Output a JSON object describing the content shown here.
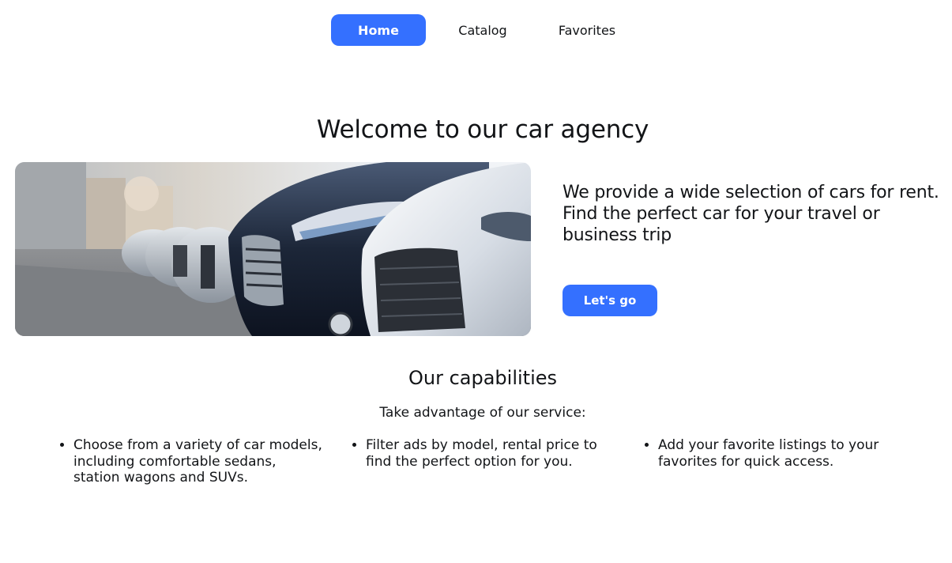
{
  "nav": {
    "items": [
      {
        "label": "Home",
        "active": true
      },
      {
        "label": "Catalog",
        "active": false
      },
      {
        "label": "Favorites",
        "active": false
      }
    ]
  },
  "hero": {
    "title": "Welcome to our car agency",
    "description": "We provide a wide selection of cars for rent. Find the perfect car for your travel or business trip",
    "cta_label": "Let's go"
  },
  "capabilities": {
    "title": "Our capabilities",
    "subtitle": "Take advantage of our service:",
    "items": [
      "Choose from a variety of car models, including comfortable sedans, station wagons and SUVs.",
      "Filter ads by model, rental price to find the perfect option for you.",
      "Add your favorite listings to your favorites for quick access."
    ]
  },
  "colors": {
    "accent": "#3470ff",
    "text": "#121417",
    "background": "#ffffff"
  }
}
